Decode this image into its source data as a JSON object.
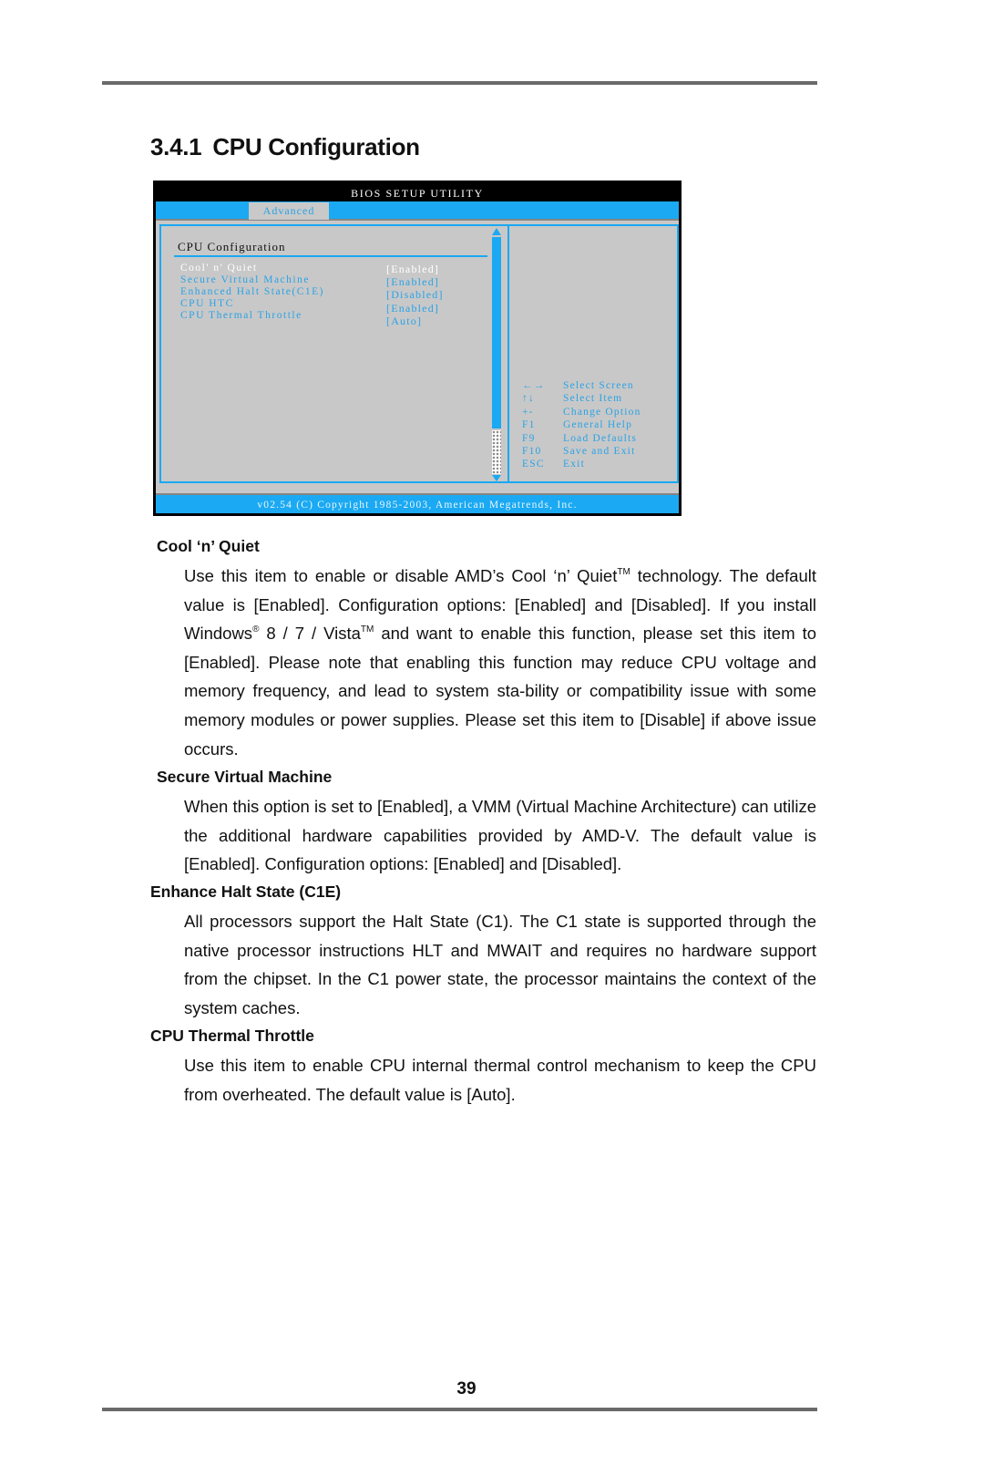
{
  "page": {
    "section_number": "3.4.1",
    "section_title": "CPU Configuration",
    "page_number": "39"
  },
  "bios": {
    "title": "BIOS SETUP UTILITY",
    "active_tab": "Advanced",
    "section_title": "CPU Configuration",
    "items": [
      {
        "label": "Cool' n' Quiet",
        "value": "[Enabled]",
        "selected": true
      },
      {
        "label": "Secure Virtual Machine",
        "value": "[Enabled]",
        "selected": false
      },
      {
        "label": "Enhanced Halt State(C1E)",
        "value": "[Disabled]",
        "selected": false
      },
      {
        "label": "CPU HTC",
        "value": "[Enabled]",
        "selected": false
      },
      {
        "label": "CPU Thermal Throttle",
        "value": "[Auto]",
        "selected": false
      }
    ],
    "help_keys": [
      {
        "key": "←→",
        "action": "Select Screen"
      },
      {
        "key": "↑↓",
        "action": "Select Item"
      },
      {
        "key": "+-",
        "action": "Change Option"
      },
      {
        "key": "F1",
        "action": "General Help"
      },
      {
        "key": "F9",
        "action": "Load Defaults"
      },
      {
        "key": "F10",
        "action": "Save and Exit"
      },
      {
        "key": "ESC",
        "action": "Exit"
      }
    ],
    "footer": "v02.54 (C) Copyright 1985-2003, American Megatrends, Inc.",
    "colors": {
      "accent": "#1aa9f2",
      "panel": "#c8c8c8",
      "title_bar": "#000000",
      "item_text": "#2aa3e6",
      "selected_text": "#ffffff"
    }
  },
  "sections": [
    {
      "heading": "Cool ‘n’ Quiet",
      "lines": [
        "Use this item to enable or disable AMD’s Cool ‘n’ Quiet™ technology. The default value is [Enabled]. Configuration options: [Enabled] and [Disabled]. If you install Windows® 8 / 7 / Vista™ and want to enable this function, please set this item to [Enabled]. Please note that enabling this function may reduce CPU voltage and memory frequency, and lead to system sta-bility or compatibility issue with some memory modules or power supplies. Please set this item to [Disable] if above issue occurs."
      ]
    },
    {
      "heading": "Secure Virtual Machine",
      "lines": [
        " When this option is set to [Enabled], a VMM (Virtual Machine Architecture) can utilize the additional hardware capabilities provided by AMD-V. The default value is [Enabled]. Configuration options: [Enabled] and [Disabled]."
      ]
    },
    {
      "heading": "Enhance Halt State (C1E)",
      "lines": [
        "All processors support the Halt State (C1). The C1 state is supported through the native processor instructions HLT and MWAIT and requires no hardware support from the chipset. In the C1 power state, the processor maintains the context of the system caches."
      ]
    },
    {
      "heading": "CPU Thermal Throttle",
      "lines": [
        "Use this item to enable CPU internal thermal control mechanism to keep the CPU from overheated. The default value is [Auto]."
      ]
    }
  ]
}
